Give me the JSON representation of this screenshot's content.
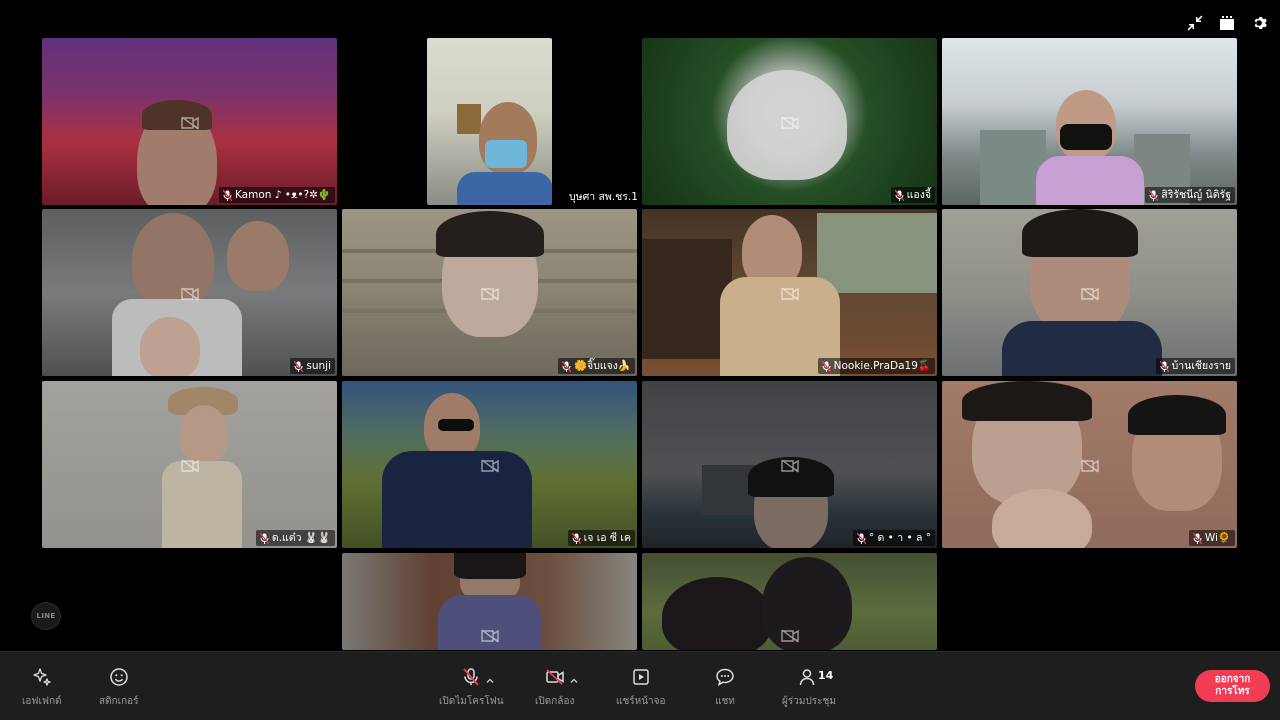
{
  "top_controls": {
    "icons": [
      "collapse-icon",
      "layout-icon",
      "settings-icon"
    ]
  },
  "participants": [
    {
      "name": "Kamon ♪ •ᴥ•?✲🌵",
      "muted": true,
      "camera_off": true
    },
    {
      "name": "บุษศา สพ.ชร.1",
      "muted": false,
      "camera_off": false
    },
    {
      "name": "แองจี้",
      "muted": true,
      "camera_off": true
    },
    {
      "name": "สิริรัชนีญ์ นิติรัฐ",
      "muted": true,
      "camera_off": false
    },
    {
      "name": "sunji",
      "muted": true,
      "camera_off": true
    },
    {
      "name": "🌼จิ๊บแจง🍌",
      "muted": true,
      "camera_off": true
    },
    {
      "name": "Nookie.PraDa19🍒",
      "muted": true,
      "camera_off": true
    },
    {
      "name": "บ้านเชียงราย",
      "muted": true,
      "camera_off": true
    },
    {
      "name": "ด.แต๋ว 🐰🐰",
      "muted": true,
      "camera_off": true
    },
    {
      "name": "เจ เอ ซี เค",
      "muted": true,
      "camera_off": true
    },
    {
      "name": "° ด • า • ล °",
      "muted": true,
      "camera_off": true
    },
    {
      "name": "Wi🌻",
      "muted": true,
      "camera_off": true
    },
    {
      "name": "",
      "muted": true,
      "camera_off": true
    },
    {
      "name": "",
      "muted": true,
      "camera_off": true
    }
  ],
  "brand": {
    "logo_text": "LINE"
  },
  "toolbar": {
    "effects": "เอฟเฟกต์",
    "stickers": "สติกเกอร์",
    "mic": "เปิดไมโครโฟน",
    "camera": "เปิดกล้อง",
    "share": "แชร์หน้าจอ",
    "chat": "แชท",
    "participants": "ผู้ร่วมประชุม",
    "participant_count": "14",
    "leave_line1": "ออกจาก",
    "leave_line2": "การโทร"
  },
  "colors": {
    "leave": "#f23c55",
    "toolbar_bg": "#1e1e1e",
    "background": "#000000"
  }
}
